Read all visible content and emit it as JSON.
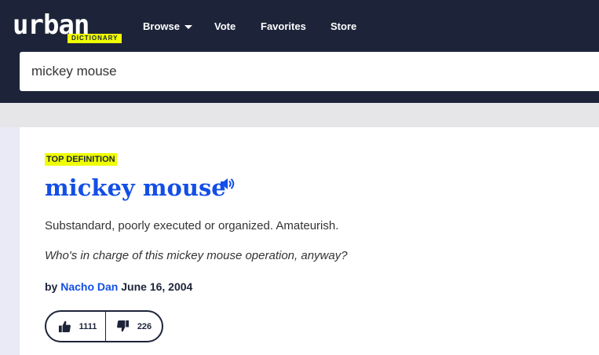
{
  "header": {
    "logo": {
      "word": "urban",
      "tag": "DICTIONARY"
    },
    "nav": {
      "browse": "Browse",
      "vote": "Vote",
      "favorites": "Favorites",
      "store": "Store"
    },
    "search": {
      "value": "mickey mouse"
    }
  },
  "definition": {
    "badge": "TOP DEFINITION",
    "word": "mickey mouse",
    "meaning": "Substandard, poorly executed or organized. Amateurish.",
    "example": "Who's in charge of this mickey mouse operation, anyway?",
    "by_prefix": "by",
    "author": "Nacho Dan",
    "date": "June 16, 2004",
    "upvotes": "1111",
    "downvotes": "226"
  },
  "colors": {
    "header_bg": "#1d2439",
    "accent_yellow": "#efff00",
    "link_blue": "#134fe6"
  },
  "icons": {
    "speaker": "speaker-icon",
    "thumbs_up": "thumbs-up-icon",
    "thumbs_down": "thumbs-down-icon",
    "caret": "chevron-down-icon"
  }
}
